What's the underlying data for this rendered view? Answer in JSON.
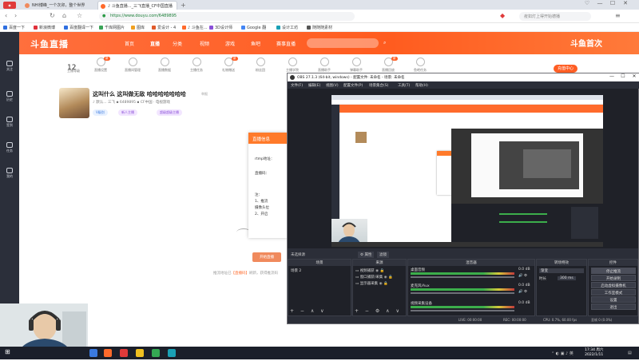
{
  "browser": {
    "tabs": [
      {
        "label": "NHl博峰_一个次卯，整个世界",
        "color": "#f08a5d"
      },
      {
        "label": "♪ 斗鱼直播..._三飞直播_CF中国直播",
        "color": "#ff6a2b"
      }
    ],
    "new_tab": "+",
    "window_controls": [
      "♡",
      "—",
      "☐",
      "✕"
    ],
    "url": "https://www.douyu.com/6489895",
    "search_placeholder": "疫如灯上得开始德播",
    "bookmarks": [
      {
        "label": "百度一下",
        "color": "#2f6fe0"
      },
      {
        "label": "新浪微博",
        "color": "#e0313b"
      },
      {
        "label": "百度翻译一下",
        "color": "#2f6fe0"
      },
      {
        "label": "千库网图片",
        "color": "#3aa457"
      },
      {
        "label": "图库",
        "color": "#f0a020"
      },
      {
        "label": "爱设计 - 4",
        "color": "#e05a2a"
      },
      {
        "label": "♪ 斗鱼在...",
        "color": "#ff6a2b"
      },
      {
        "label": "3D设计师",
        "color": "#8a4fd8"
      },
      {
        "label": "Google 翻",
        "color": "#4285f4"
      },
      {
        "label": "设计工坊",
        "color": "#1aa0b5"
      },
      {
        "label": "随随随素材",
        "color": "#555555"
      }
    ]
  },
  "site": {
    "logo": "斗鱼直播",
    "nav": [
      "首页",
      "直播",
      "分类",
      "视频",
      "游戏",
      "鱼吧",
      "赛事直播"
    ],
    "header_art": "斗鱼首次",
    "sidebar": [
      "关注",
      "历史",
      "签到",
      "任务",
      "我的"
    ],
    "tools": [
      {
        "label": "主播等级",
        "badge": ""
      },
      {
        "label": "直播设置",
        "badge": "新"
      },
      {
        "label": "直播间管理",
        "badge": ""
      },
      {
        "label": "直播数据",
        "badge": ""
      },
      {
        "label": "主播任务",
        "badge": ""
      },
      {
        "label": "礼物赠送",
        "badge": "新"
      },
      {
        "label": "粉丝团",
        "badge": ""
      },
      {
        "label": "主播学院",
        "badge": ""
      },
      {
        "label": "直播助手",
        "badge": ""
      },
      {
        "label": "弹幕助手",
        "badge": ""
      },
      {
        "label": "直播回放",
        "badge": "新"
      },
      {
        "label": "鱼吧任务",
        "badge": ""
      }
    ],
    "level_count": "12",
    "recharge": "充值中心",
    "room": {
      "title": "这叫什么 这叫做无敌 哈哈哈哈哈哈哈",
      "report": "举报",
      "meta": "♪ 默认... 三飞  ▪  6489895  ▪  CF中国 · 电视游戏",
      "tags": [
        "V级别",
        "新人主播",
        "超级超级主播"
      ]
    },
    "guide": {
      "heading": "直播信息",
      "rtmp_label": "rtmp地址：",
      "key_label": "直播码：",
      "note_label": "注：",
      "note_1": "1、推流",
      "note_2": "摄像头位",
      "note_3": "2、开启"
    },
    "start_button": "开始直播",
    "tip_prefix": "推流地址已",
    "tip_highlight": "【直播码】",
    "tip_suffix": "刷新，获得推流码"
  },
  "obs": {
    "title": "OBS 27.1.3 (64-bit, windows) - 配置文件: 未命名 - 场景: 未命名",
    "menu": [
      "文件(F)",
      "编辑(E)",
      "视图(V)",
      "配置文件(P)",
      "场景集合(S)",
      "工具(T)",
      "帮助(H)"
    ],
    "scene_label": "未选择源",
    "properties": "⚙ 属性",
    "filters": "滤镜",
    "docks": {
      "scenes": {
        "title": "场景",
        "items": [
          "场景 2"
        ]
      },
      "sources": {
        "title": "来源",
        "items": [
          "视频捕获",
          "窗口捕获/采集",
          "显示器采集"
        ]
      },
      "mixer": {
        "title": "混音器",
        "tracks": [
          {
            "name": "桌面音频",
            "db": "0.0 dB"
          },
          {
            "name": "麦克风/Aux",
            "db": "0.0 dB"
          },
          {
            "name": "视频采集设备",
            "db": "0.0 dB"
          }
        ]
      },
      "transitions": {
        "title": "转场特效",
        "type": "渐变",
        "duration_label": "时长",
        "duration": "300 ms"
      },
      "controls": {
        "title": "控件",
        "buttons": [
          "停止推流",
          "开始录制",
          "启动虚拟摄像机",
          "工作室模式",
          "设置",
          "退出"
        ]
      }
    },
    "status": {
      "live": "LIVE: 00:00:00",
      "rec": "REC: 00:00:00",
      "cpu": "CPU: 0.7%, 60.00 fps",
      "dropped": "丢帧 0 (0.0%)"
    }
  },
  "taskbar": {
    "time": "17:34 周六",
    "date": "2022/1/11",
    "apps": [
      "#3b7ae0",
      "#ff6a2b",
      "#e03a3a",
      "#f0c020",
      "#34a853",
      "#1aa0b5"
    ]
  }
}
